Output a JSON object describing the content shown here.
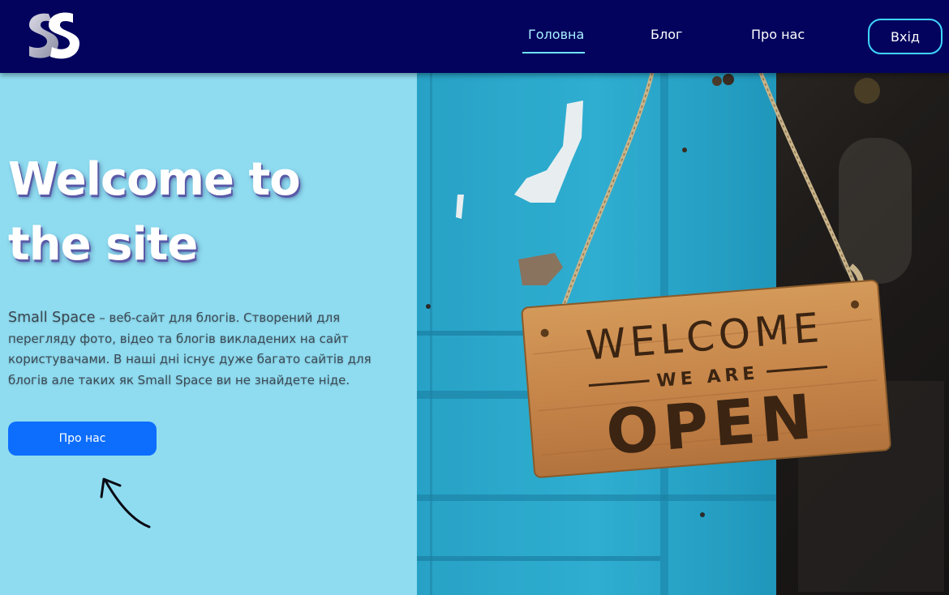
{
  "header": {
    "logo_icon": "ss-logo-icon",
    "nav": [
      {
        "label": "Головна",
        "active": true
      },
      {
        "label": "Блог",
        "active": false
      },
      {
        "label": "Про нас",
        "active": false
      }
    ],
    "login_label": "Вхід"
  },
  "hero": {
    "title_line1": "Welcome to",
    "title_line2": "the site",
    "brand": "Small Space",
    "description": " – веб-сайт для блогів. Створений для перегляду фото, відео та блогів викладених на сайт користувачами. В наші дні існує дуже багато сайтів для блогів але таких як Small Space ви не знайдете ніде.",
    "button_label": "Про нас",
    "arrow_icon": "curved-arrow-icon"
  },
  "photo": {
    "sign_line1": "WELCOME",
    "sign_line2": "WE ARE",
    "sign_line3": "OPEN"
  },
  "colors": {
    "header_bg": "#03035e",
    "hero_bg": "#8fdcf0",
    "accent": "#0d6efd",
    "nav_active": "#a9f0ff",
    "login_border": "#3fd5ff"
  }
}
